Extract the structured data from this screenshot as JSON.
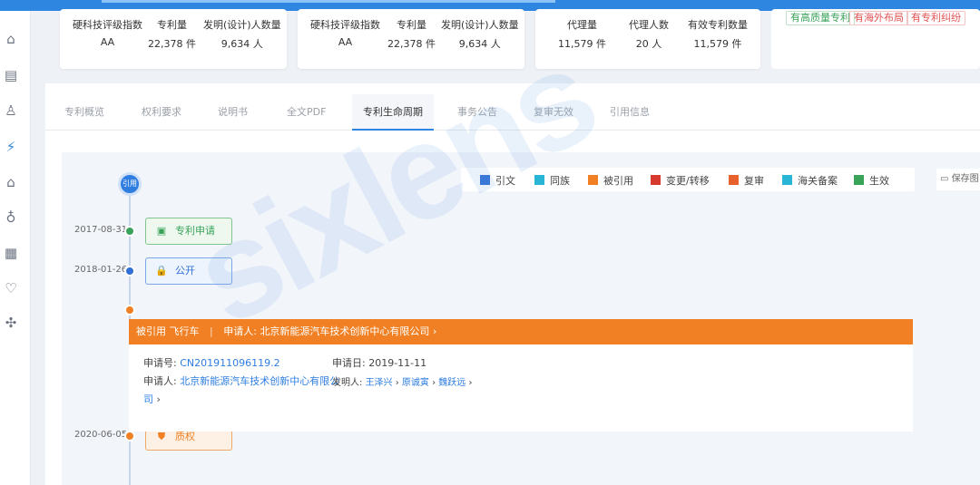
{
  "stats_cards": [
    {
      "cols": [
        {
          "label": "硬科技评级指数",
          "value": "AA"
        },
        {
          "label": "专利量",
          "value": "22,378 件"
        },
        {
          "label": "发明(设计)人数量",
          "value": "9,634 人"
        }
      ]
    },
    {
      "cols": [
        {
          "label": "硬科技评级指数",
          "value": "AA"
        },
        {
          "label": "专利量",
          "value": "22,378 件"
        },
        {
          "label": "发明(设计)人数量",
          "value": "9,634 人"
        }
      ]
    },
    {
      "cols": [
        {
          "label": "代理量",
          "value": "11,579 件"
        },
        {
          "label": "代理人数",
          "value": "20 人"
        },
        {
          "label": "有效专利数量",
          "value": "11,579 件"
        }
      ]
    }
  ],
  "tags": [
    {
      "text": "有高质量专利",
      "color": "#3aa35a"
    },
    {
      "text": "有海外布局",
      "color": "#e05050"
    },
    {
      "text": "有专利纠纷",
      "color": "#e05050"
    }
  ],
  "tabs": [
    "专利概览",
    "权利要求",
    "说明书",
    "全文PDF",
    "专利生命周期",
    "事务公告",
    "复审无效",
    "引用信息"
  ],
  "active_tab": "专利生命周期",
  "timeline": {
    "start_node": "引用",
    "legend": [
      {
        "label": "引文",
        "color": "#2f6fd6"
      },
      {
        "label": "同族",
        "color": "#29b6d6"
      },
      {
        "label": "被引用",
        "color": "#f08023"
      },
      {
        "label": "变更/转移",
        "color": "#d63a2f"
      },
      {
        "label": "复审",
        "color": "#e8602c"
      },
      {
        "label": "海关备案",
        "color": "#29b6d6"
      },
      {
        "label": "生效",
        "color": "#3aa35a"
      }
    ],
    "save_label": "保存图",
    "events": [
      {
        "date": "2017-08-31",
        "label": "专利申请",
        "icon": "certificate-icon",
        "color": "#3aa35a"
      },
      {
        "date": "2018-01-26",
        "label": "公开",
        "icon": "lock-icon",
        "color": "#2f6fd6"
      },
      {
        "date": "2020-06-05",
        "label": "质权",
        "icon": "shield-icon",
        "color": "#f08023"
      }
    ],
    "citation": {
      "head_tag": "被引用",
      "head_title": "飞行车",
      "head_applicant_prefix": "申请人:",
      "head_applicant": "北京新能源汽车技术创新中心有限公司",
      "app_no_label": "申请号:",
      "app_no": "CN201911096119.2",
      "app_date_label": "申请日:",
      "app_date": "2019-11-11",
      "applicant_label": "申请人:",
      "applicant_part1": "北京新能源汽车技术创新中心有限公",
      "applicant_part2": "司",
      "inventor_label": "发明人:",
      "inventors": [
        "王泽兴",
        "原诚寅",
        "魏跃远"
      ]
    }
  },
  "watermark": "sixlens"
}
